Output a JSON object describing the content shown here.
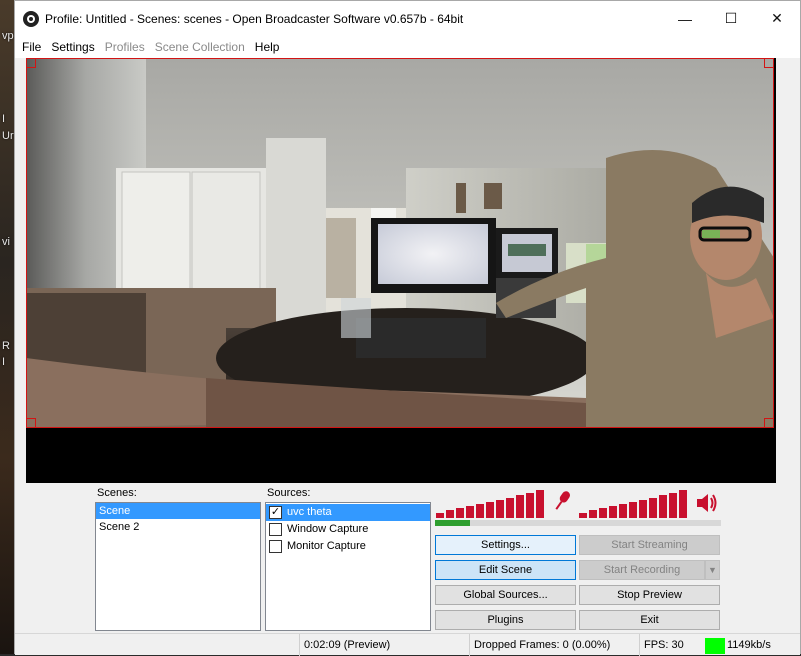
{
  "window": {
    "title": "Profile: Untitled - Scenes: scenes - Open Broadcaster Software v0.657b - 64bit",
    "controls": {
      "minimize": "—",
      "maximize": "☐",
      "close": "✕"
    }
  },
  "menu": {
    "items": [
      {
        "label": "File",
        "enabled": true
      },
      {
        "label": "Settings",
        "enabled": true
      },
      {
        "label": "Profiles",
        "enabled": false
      },
      {
        "label": "Scene Collection",
        "enabled": false
      },
      {
        "label": "Help",
        "enabled": true
      }
    ]
  },
  "scenes": {
    "label": "Scenes:",
    "items": [
      {
        "label": "Scene",
        "selected": true
      },
      {
        "label": "Scene 2",
        "selected": false
      }
    ]
  },
  "sources": {
    "label": "Sources:",
    "items": [
      {
        "label": "uvc theta",
        "checked": true,
        "selected": true
      },
      {
        "label": "Window Capture",
        "checked": false,
        "selected": false
      },
      {
        "label": "Monitor Capture",
        "checked": false,
        "selected": false
      }
    ]
  },
  "meters": {
    "mic": {
      "icon": "microphone-icon",
      "level": 0.25,
      "color": "#c8102e"
    },
    "desktop": {
      "icon": "speaker-icon",
      "level": 0.0,
      "color": "#c8102e"
    },
    "level_color": "#2e9e2e"
  },
  "buttons": {
    "settings": "Settings...",
    "start_streaming": "Start Streaming",
    "edit_scene": "Edit Scene",
    "start_recording": "Start Recording",
    "global_sources": "Global Sources...",
    "stop_preview": "Stop Preview",
    "plugins": "Plugins",
    "exit": "Exit"
  },
  "status": {
    "time": "0:02:09 (Preview)",
    "dropped": "Dropped Frames: 0 (0.00%)",
    "fps": "FPS: 30",
    "bitrate": "1149kb/s",
    "bitrate_color": "#00ff00"
  },
  "desktop_text": [
    "vp",
    "I",
    "Ur",
    "vi",
    "R",
    "I"
  ]
}
